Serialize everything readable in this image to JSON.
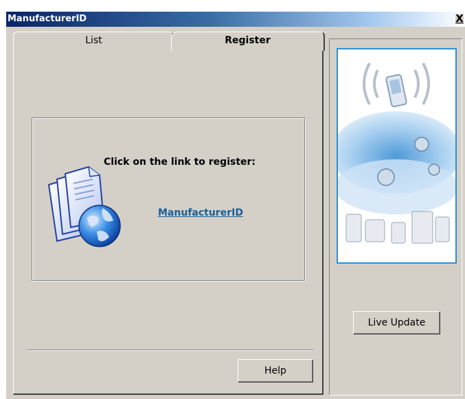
{
  "window": {
    "title": "ManufacturerID",
    "close_glyph": "X"
  },
  "tabs": [
    {
      "label": "List",
      "active": false
    },
    {
      "label": "Register",
      "active": true
    }
  ],
  "register": {
    "prompt": "Click on the link to register:",
    "link_text": "ManufacturerID",
    "icon": "documents-globe-icon"
  },
  "buttons": {
    "help": "Help",
    "live_update": "Live Update"
  },
  "banner": {
    "icon": "wireless-devices-banner"
  },
  "colors": {
    "title_bar_start": "#0a246a",
    "face": "#d4d0c8",
    "link": "#1a5e96",
    "banner_border": "#2e8fd6"
  }
}
